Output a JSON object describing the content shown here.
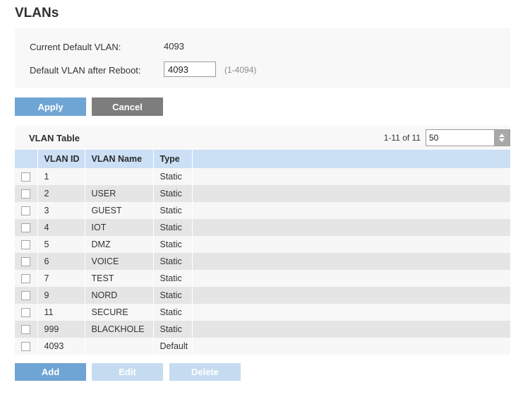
{
  "page": {
    "title": "VLANs"
  },
  "settings": {
    "current_label": "Current Default VLAN:",
    "current_value": "4093",
    "reboot_label": "Default VLAN after Reboot:",
    "reboot_value": "4093",
    "reboot_placeholder": "",
    "reboot_hint": "(1-4094)"
  },
  "actions": {
    "apply_label": "Apply",
    "cancel_label": "Cancel",
    "add_label": "Add",
    "edit_label": "Edit",
    "delete_label": "Delete"
  },
  "table": {
    "caption": "VLAN Table",
    "pager_count": "1-11 of 11",
    "page_size_value": "50",
    "page_size_placeholder": "",
    "spinner_up_icon": "triangle-up-icon",
    "spinner_down_icon": "triangle-down-icon",
    "columns": [
      "",
      "VLAN ID",
      "VLAN Name",
      "Type",
      ""
    ],
    "rows": [
      {
        "checked": false,
        "vlan_id": "1",
        "vlan_name": "",
        "type": "Static"
      },
      {
        "checked": false,
        "vlan_id": "2",
        "vlan_name": "USER",
        "type": "Static"
      },
      {
        "checked": false,
        "vlan_id": "3",
        "vlan_name": "GUEST",
        "type": "Static"
      },
      {
        "checked": false,
        "vlan_id": "4",
        "vlan_name": "IOT",
        "type": "Static"
      },
      {
        "checked": false,
        "vlan_id": "5",
        "vlan_name": "DMZ",
        "type": "Static"
      },
      {
        "checked": false,
        "vlan_id": "6",
        "vlan_name": "VOICE",
        "type": "Static"
      },
      {
        "checked": false,
        "vlan_id": "7",
        "vlan_name": "TEST",
        "type": "Static"
      },
      {
        "checked": false,
        "vlan_id": "9",
        "vlan_name": "NORD",
        "type": "Static"
      },
      {
        "checked": false,
        "vlan_id": "11",
        "vlan_name": "SECURE",
        "type": "Static"
      },
      {
        "checked": false,
        "vlan_id": "999",
        "vlan_name": "BLACKHOLE",
        "type": "Static"
      },
      {
        "checked": false,
        "vlan_id": "4093",
        "vlan_name": "",
        "type": "Default"
      }
    ]
  },
  "colors": {
    "accent_blue": "#6fa5d4",
    "header_blue": "#cbdff5",
    "disabled_blue": "#c5dcf0",
    "cancel_gray": "#7d7d7d",
    "panel_gray": "#f8f8f8",
    "row_odd": "#f7f7f7",
    "row_even": "#e5e5e5"
  }
}
